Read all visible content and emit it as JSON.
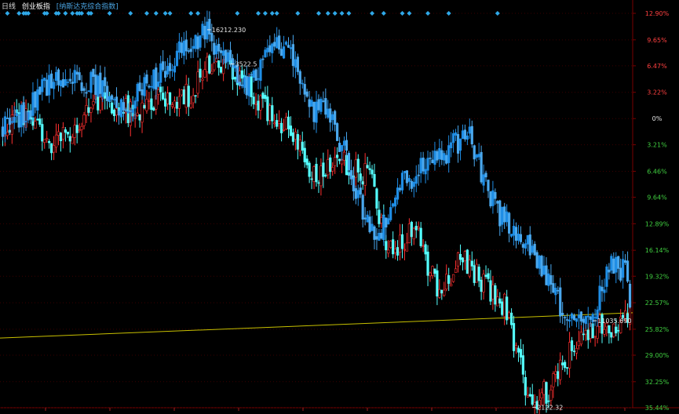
{
  "header": {
    "period": "日线",
    "index_name": "创业板指",
    "compare_name": "[纳斯达克综合指数]"
  },
  "chart_data": {
    "type": "candlestick",
    "ylabel_ticks": [
      "12.90%",
      "9.65%",
      "6.47%",
      "3.22%",
      "0%",
      "3.21%",
      "6.46%",
      "9.64%",
      "12.89%",
      "16.14%",
      "19.32%",
      "22.57%",
      "25.82%",
      "29.00%",
      "32.25%",
      "35.44%"
    ],
    "ylim": [
      -12.9,
      35.44
    ],
    "y_tick_values": [
      -12.9,
      -9.65,
      -6.47,
      -3.22,
      0,
      3.21,
      6.46,
      9.64,
      12.89,
      16.14,
      19.32,
      22.57,
      25.82,
      29.0,
      32.25,
      35.44
    ],
    "grid": true,
    "annotations": [
      {
        "text": "16212.230",
        "series": "纳斯达克综合指数",
        "pct": -10.6
      },
      {
        "text": "3522.5",
        "series": "创业板指",
        "pct": -6.4
      },
      {
        "text": "11035.690",
        "series": "纳斯达克综合指数",
        "pct": 24.3
      },
      {
        "text": "2122.32",
        "series": "创业板指",
        "pct": 34.8
      }
    ],
    "series": [
      {
        "name": "纳斯达克综合指数",
        "anchors": [
          [
            0,
            1
          ],
          [
            10,
            -1
          ],
          [
            20,
            -4.5
          ],
          [
            30,
            -5
          ],
          [
            40,
            -4
          ],
          [
            50,
            -1.5
          ],
          [
            58,
            -3
          ],
          [
            70,
            -6
          ],
          [
            78,
            -9
          ],
          [
            88,
            -10.6
          ],
          [
            96,
            -7.5
          ],
          [
            104,
            -4
          ],
          [
            112,
            -7
          ],
          [
            120,
            -9
          ],
          [
            126,
            -7
          ],
          [
            134,
            -1
          ],
          [
            140,
            -1
          ],
          [
            148,
            5
          ],
          [
            160,
            15
          ],
          [
            172,
            8
          ],
          [
            182,
            6
          ],
          [
            192,
            4
          ],
          [
            200,
            1.5
          ],
          [
            212,
            11
          ],
          [
            222,
            14
          ],
          [
            230,
            17
          ],
          [
            238,
            22
          ],
          [
            246,
            25
          ],
          [
            254,
            24.3
          ],
          [
            262,
            18
          ],
          [
            268,
            19
          ],
          [
            270,
            22
          ]
        ]
      },
      {
        "name": "创业板指",
        "anchors": [
          [
            0,
            1.5
          ],
          [
            10,
            -1
          ],
          [
            20,
            3
          ],
          [
            30,
            2
          ],
          [
            40,
            -2
          ],
          [
            50,
            -1
          ],
          [
            58,
            -1
          ],
          [
            70,
            -2.5
          ],
          [
            80,
            -3
          ],
          [
            88,
            -6
          ],
          [
            98,
            -6.4
          ],
          [
            106,
            -4
          ],
          [
            114,
            -1
          ],
          [
            124,
            2
          ],
          [
            134,
            7
          ],
          [
            146,
            5
          ],
          [
            158,
            7
          ],
          [
            166,
            16
          ],
          [
            178,
            14
          ],
          [
            188,
            22
          ],
          [
            198,
            17
          ],
          [
            204,
            19
          ],
          [
            216,
            23
          ],
          [
            222,
            30
          ],
          [
            228,
            34.8
          ],
          [
            236,
            33
          ],
          [
            246,
            28
          ],
          [
            256,
            25
          ],
          [
            262,
            27
          ],
          [
            270,
            23
          ]
        ]
      }
    ],
    "diamond_markers": [
      2,
      7,
      9,
      10,
      11,
      18,
      19,
      23,
      24,
      27,
      30,
      32,
      33,
      34,
      37,
      38,
      46,
      55,
      62,
      66,
      70,
      72,
      81,
      84,
      101,
      110,
      113,
      116,
      118,
      127,
      136,
      140,
      143,
      146,
      149,
      159,
      164,
      172,
      175,
      183,
      192,
      213
    ]
  }
}
